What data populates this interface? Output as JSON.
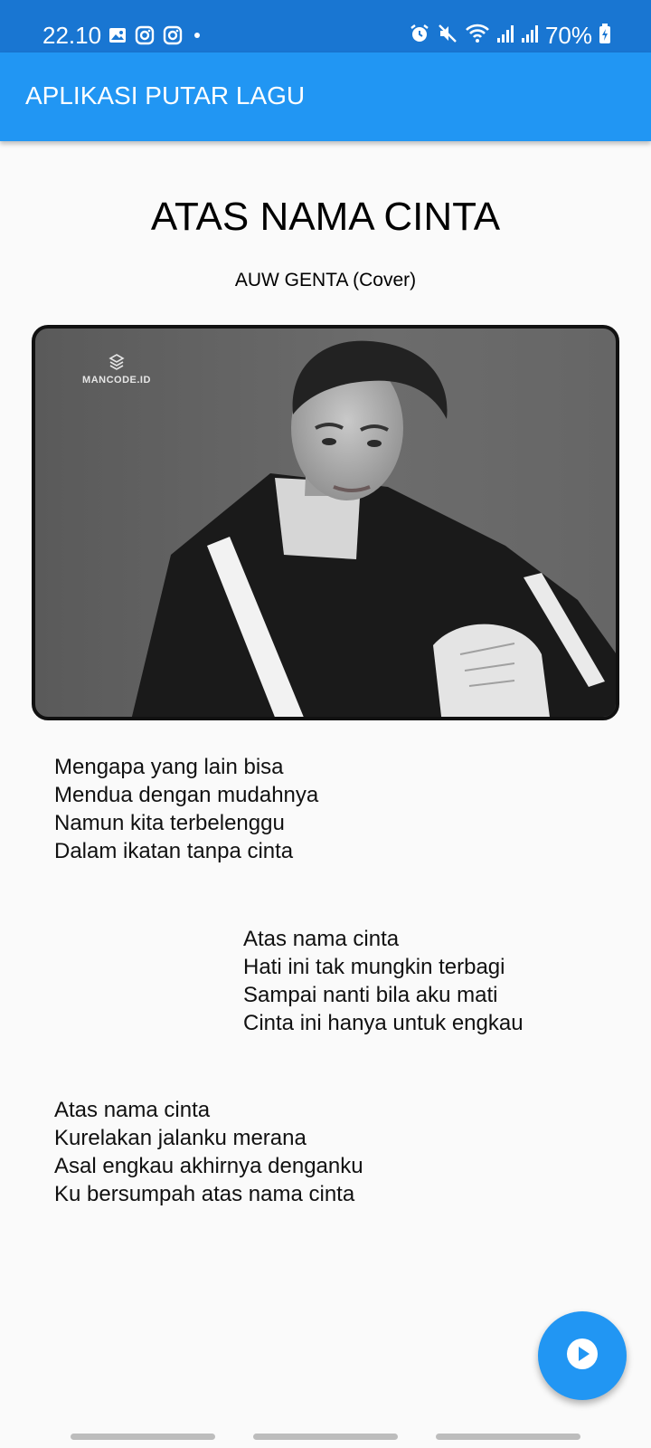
{
  "status_bar": {
    "time": "22.10",
    "battery": "70%",
    "left_icons": [
      "gallery-icon",
      "instagram-icon",
      "instagram-icon",
      "dot-icon"
    ],
    "right_icons": [
      "alarm-icon",
      "mute-icon",
      "wifi-icon",
      "signal-icon",
      "signal-icon",
      "battery-charging-icon"
    ]
  },
  "app_bar": {
    "title": "APLIKASI PUTAR LAGU",
    "color": "#2196F3"
  },
  "song": {
    "title": "ATAS NAMA CINTA",
    "artist": "AUW GENTA (Cover)"
  },
  "cover": {
    "watermark": "MANCODE.ID"
  },
  "lyrics": {
    "verse1": [
      "Mengapa yang lain bisa",
      "Mendua dengan mudahnya",
      "Namun kita terbelenggu",
      "Dalam ikatan tanpa cinta"
    ],
    "verse2": [
      "Atas nama cinta",
      "Hati ini tak mungkin terbagi",
      "Sampai nanti bila aku mati",
      "Cinta ini hanya untuk engkau"
    ],
    "verse3": [
      "Atas nama cinta",
      "Kurelakan jalanku merana",
      "Asal engkau akhirnya denganku",
      "Ku bersumpah atas nama cinta"
    ]
  },
  "fab": {
    "icon": "play-icon",
    "color": "#2196F3"
  }
}
